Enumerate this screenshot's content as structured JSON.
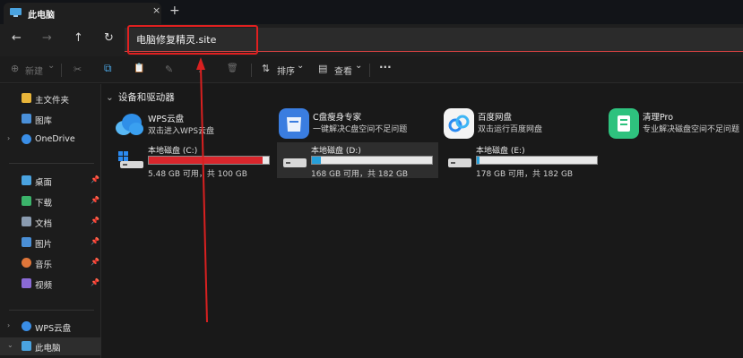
{
  "window": {
    "tab_title": "此电脑",
    "tab_close": "×",
    "tab_new": "+"
  },
  "nav": {
    "back": "←",
    "forward": "→",
    "up": "↑",
    "refresh": "↻",
    "address_text": "电脑修复精灵.site"
  },
  "toolbar": {
    "new_icon": "⊕",
    "new_label": "新建",
    "new_chevron": "⌄",
    "cut_icon": "✂",
    "copy_icon": "⧉",
    "paste_icon": "📋",
    "rename_icon": "✎",
    "share_icon": "⇪",
    "delete_icon": "🗑",
    "sort_icon": "⇅",
    "sort_label": "排序",
    "sort_chevron": "⌄",
    "view_icon": "▤",
    "view_label": "查看",
    "view_chevron": "⌄",
    "more": "···"
  },
  "sidebar": {
    "items": [
      {
        "label": "主文件夹",
        "icon": "home-icon",
        "color": "#e8b53a"
      },
      {
        "label": "图库",
        "icon": "gallery-icon",
        "color": "#4a90d9"
      },
      {
        "label": "OneDrive",
        "icon": "cloud-icon",
        "color": "#3a8ee6",
        "chevron": "›"
      },
      {
        "label": "桌面",
        "icon": "desktop-icon",
        "color": "#4aa3e0",
        "pin": "📌"
      },
      {
        "label": "下载",
        "icon": "download-icon",
        "color": "#3bb36a",
        "pin": "📌"
      },
      {
        "label": "文档",
        "icon": "document-icon",
        "color": "#8a9bb0",
        "pin": "📌"
      },
      {
        "label": "图片",
        "icon": "pictures-icon",
        "color": "#4a8fd6",
        "pin": "📌"
      },
      {
        "label": "音乐",
        "icon": "music-icon",
        "color": "#e0763a",
        "pin": "📌"
      },
      {
        "label": "视频",
        "icon": "video-icon",
        "color": "#8a6ad6",
        "pin": "📌"
      },
      {
        "label": "WPS云盘",
        "icon": "wps-cloud-icon",
        "color": "#3a8ee6",
        "chevron": "›"
      },
      {
        "label": "此电脑",
        "icon": "computer-icon",
        "color": "#4aa3e0",
        "chevron": "⌄"
      }
    ]
  },
  "content": {
    "section_chevron": "⌄",
    "section_title": "设备和驱动器",
    "apps": [
      {
        "name": "WPS云盘",
        "desc": "双击进入WPS云盘",
        "color": "#2f8fe8"
      },
      {
        "name": "C盘瘦身专家",
        "desc": "一键解决C盘空间不足问题",
        "color": "#3a7de0"
      },
      {
        "name": "百度网盘",
        "desc": "双击运行百度网盘",
        "color": "#f4f4f4"
      },
      {
        "name": "清理Pro",
        "desc": "专业解决磁盘空间不足问题",
        "color": "#2ec27e"
      }
    ],
    "drives": [
      {
        "name": "本地磁盘 (C:)",
        "size": "5.48 GB 可用，共 100 GB",
        "used": 0.945,
        "color": "#d9262c"
      },
      {
        "name": "本地磁盘 (D:)",
        "size": "168 GB 可用，共 182 GB",
        "used": 0.077,
        "color": "#26a0da"
      },
      {
        "name": "本地磁盘 (E:)",
        "size": "178 GB 可用，共 182 GB",
        "used": 0.022,
        "color": "#26a0da"
      }
    ]
  }
}
